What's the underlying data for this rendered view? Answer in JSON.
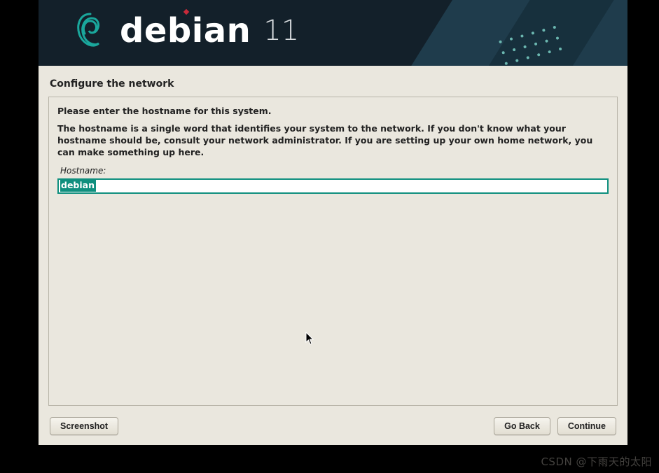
{
  "banner": {
    "brand": "debian",
    "version": "11"
  },
  "step_title": "Configure the network",
  "instructions": {
    "line1": "Please enter the hostname for this system.",
    "line2": "The hostname is a single word that identifies your system to the network. If you don't know what your hostname should be, consult your network administrator. If you are setting up your own home network, you can make something up here."
  },
  "field": {
    "label": "Hostname:",
    "value": "debian"
  },
  "buttons": {
    "screenshot": "Screenshot",
    "go_back": "Go Back",
    "continue": "Continue"
  },
  "watermark": "CSDN @下雨天的太阳"
}
